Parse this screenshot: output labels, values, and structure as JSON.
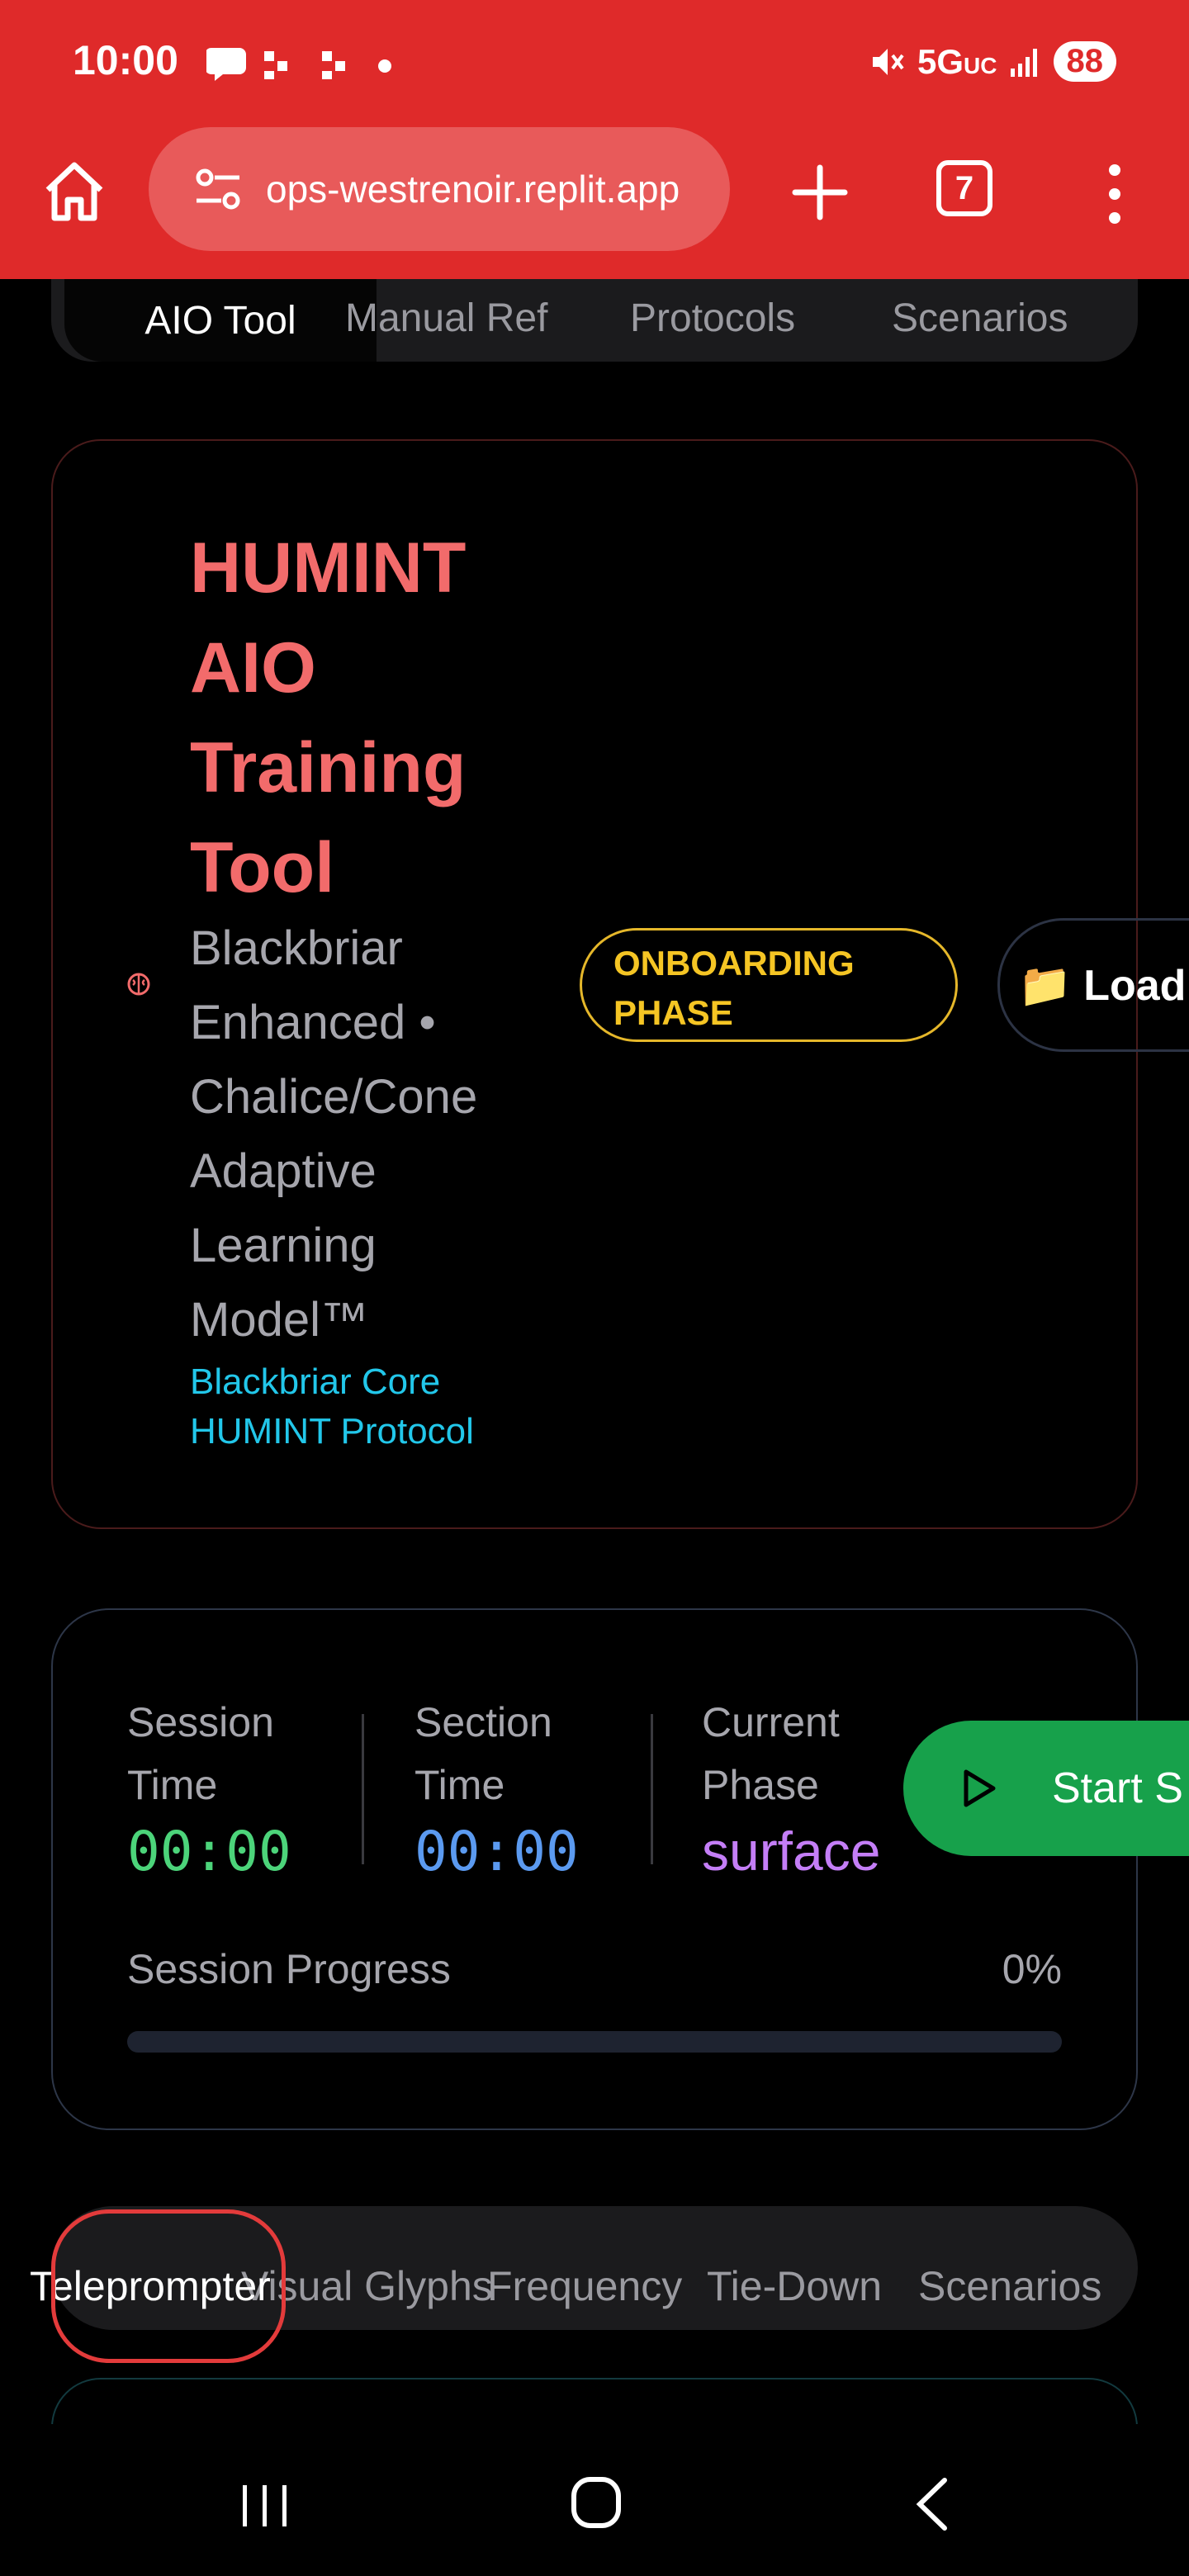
{
  "status_bar": {
    "time": "10:00",
    "left_icons": [
      "chat-bubble-icon",
      "app-icon",
      "app-icon",
      "dot-icon"
    ],
    "network": "5G",
    "network_suffix": "UC",
    "battery": "88",
    "icons": [
      "mute-icon",
      "signal-icon"
    ]
  },
  "browser": {
    "url": "ops-westrenoir.replit.app",
    "tab_count": "7"
  },
  "top_tabs": [
    {
      "label": "AIO Tool",
      "active": true
    },
    {
      "label": "Manual Ref",
      "active": false
    },
    {
      "label": "Protocols",
      "active": false
    },
    {
      "label": "Scenarios",
      "active": false
    }
  ],
  "header": {
    "title": "HUMINT AIO Training Tool",
    "subtitle": "Blackbriar Enhanced • Chalice/Cone Adaptive Learning Model™",
    "core_link": "Blackbriar Core HUMINT Protocol",
    "phase_badge": "ONBOARDING PHASE",
    "load_button": "📁 Load",
    "accent_color": "#f26b6b"
  },
  "timer": {
    "session_time_label": "Session Time",
    "session_time": "00:00",
    "section_time_label": "Section Time",
    "section_time": "00:00",
    "current_phase_label": "Current Phase",
    "current_phase": "surface",
    "start_button": "Start S",
    "progress_label": "Session Progress",
    "progress_pct": "0%",
    "progress_value": 0
  },
  "bottom_tabs": [
    {
      "label": "Teleprompter",
      "active": true
    },
    {
      "label": "Visual Glyphs",
      "active": false
    },
    {
      "label": "Frequency",
      "active": false
    },
    {
      "label": "Tie-Down",
      "active": false
    },
    {
      "label": "Scenarios",
      "active": false
    }
  ]
}
